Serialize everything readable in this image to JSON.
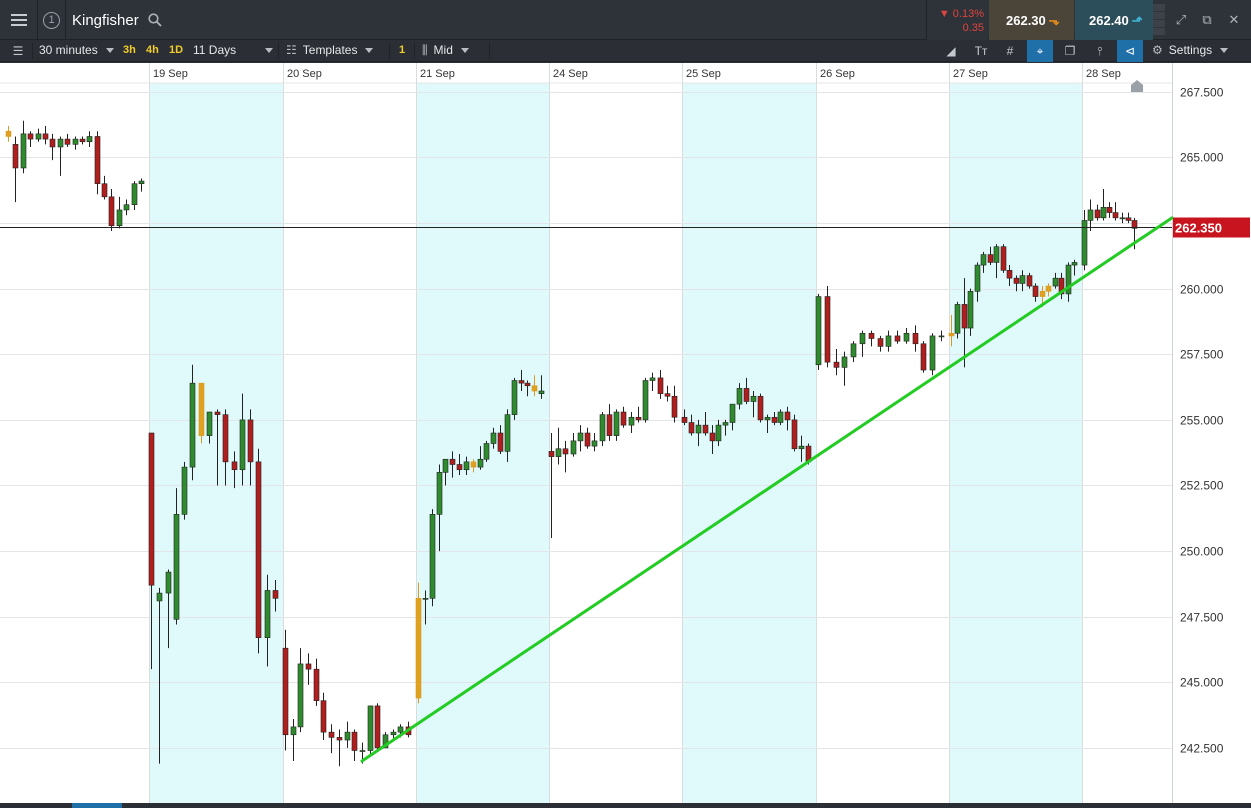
{
  "topbar": {
    "instrument": "Kingfisher",
    "window_number": "1",
    "price_change_pct": "▼ 0.13%",
    "price_change_abs": "0.35",
    "sell_price": "262.30",
    "buy_price": "262.40"
  },
  "toolbar": {
    "interval": "30 minutes",
    "preset_3h": "3h",
    "preset_4h": "4h",
    "preset_1d": "1D",
    "range": "11 Days",
    "templates": "Templates",
    "templates_count": "1",
    "price_type": "Mid",
    "settings": "Settings"
  },
  "colors": {
    "up": "#2e8b2e",
    "down": "#b01e1e",
    "trendline": "#22cc22",
    "band": "#e0fafc",
    "current_price_tag": "#c8141e"
  },
  "chart_data": {
    "type": "candlestick",
    "x_dates": [
      "19 Sep",
      "20 Sep",
      "21 Sep",
      "24 Sep",
      "25 Sep",
      "26 Sep",
      "27 Sep",
      "28 Sep"
    ],
    "y_ticks": [
      "267.500",
      "265.000",
      "262.500",
      "260.000",
      "257.500",
      "255.000",
      "252.500",
      "250.000",
      "247.500",
      "245.000",
      "242.500"
    ],
    "ylim": [
      240.4,
      268.6
    ],
    "current_price": 262.35,
    "current_price_label": "262.350",
    "trendline": {
      "from": {
        "date": "20 Sep",
        "value": 242.0
      },
      "to": {
        "date": "28 Sep",
        "value": 262.7
      }
    },
    "candles": [
      [
        265.8,
        266.2,
        265.6,
        266.0
      ],
      [
        265.5,
        265.8,
        263.3,
        264.6
      ],
      [
        264.6,
        266.4,
        264.4,
        265.9
      ],
      [
        265.9,
        266.0,
        265.4,
        265.7
      ],
      [
        265.7,
        266.1,
        265.6,
        265.9
      ],
      [
        265.9,
        266.2,
        265.5,
        265.7
      ],
      [
        265.7,
        265.9,
        264.9,
        265.4
      ],
      [
        265.4,
        265.8,
        264.3,
        265.7
      ],
      [
        265.7,
        265.9,
        265.4,
        265.5
      ],
      [
        265.5,
        265.8,
        265.3,
        265.7
      ],
      [
        265.7,
        265.8,
        265.5,
        265.6
      ],
      [
        265.6,
        266.0,
        265.4,
        265.8
      ],
      [
        265.8,
        266.0,
        263.6,
        264.0
      ],
      [
        264.0,
        264.3,
        263.4,
        263.5
      ],
      [
        263.5,
        263.8,
        262.2,
        262.4
      ],
      [
        262.4,
        263.5,
        262.3,
        263.0
      ],
      [
        263.0,
        263.4,
        262.8,
        263.2
      ],
      [
        263.2,
        264.1,
        263.0,
        264.0
      ],
      [
        264.0,
        264.2,
        263.7,
        264.1
      ],
      [
        254.5,
        254.5,
        245.5,
        248.7
      ],
      [
        248.1,
        248.6,
        241.9,
        248.4
      ],
      [
        248.4,
        249.3,
        246.3,
        249.2
      ],
      [
        247.4,
        252.4,
        247.2,
        251.4
      ],
      [
        251.4,
        253.4,
        251.2,
        253.2
      ],
      [
        253.2,
        257.1,
        252.7,
        256.4
      ],
      [
        256.4,
        256.4,
        254.1,
        254.4
      ],
      [
        254.4,
        255.3,
        254.1,
        255.3
      ],
      [
        255.3,
        255.4,
        252.5,
        255.2
      ],
      [
        255.2,
        255.4,
        252.5,
        253.4
      ],
      [
        253.4,
        253.8,
        252.4,
        253.1
      ],
      [
        253.1,
        256.0,
        252.5,
        255.0
      ],
      [
        255.0,
        255.4,
        252.5,
        253.4
      ],
      [
        253.4,
        253.9,
        246.1,
        246.7
      ],
      [
        246.7,
        249.1,
        245.6,
        248.5
      ],
      [
        248.5,
        248.9,
        247.7,
        248.2
      ],
      [
        246.3,
        247.0,
        242.4,
        243.0
      ],
      [
        243.0,
        243.6,
        242.0,
        243.3
      ],
      [
        243.3,
        246.3,
        243.1,
        245.7
      ],
      [
        245.7,
        246.1,
        244.9,
        245.5
      ],
      [
        245.5,
        245.9,
        244.1,
        244.3
      ],
      [
        244.3,
        244.6,
        242.8,
        243.1
      ],
      [
        243.1,
        243.4,
        242.3,
        242.9
      ],
      [
        242.9,
        243.2,
        241.8,
        242.8
      ],
      [
        242.8,
        243.5,
        242.5,
        243.1
      ],
      [
        243.1,
        243.2,
        242.0,
        242.4
      ],
      [
        242.4,
        242.7,
        241.9,
        242.4
      ],
      [
        242.4,
        244.1,
        242.2,
        244.1
      ],
      [
        244.1,
        244.2,
        242.4,
        242.5
      ],
      [
        242.5,
        243.1,
        242.5,
        243.0
      ],
      [
        243.0,
        243.2,
        242.8,
        243.1
      ],
      [
        243.1,
        243.4,
        242.9,
        243.3
      ],
      [
        243.3,
        243.5,
        242.9,
        243.0
      ],
      [
        244.4,
        248.8,
        244.2,
        248.2
      ],
      [
        248.2,
        248.5,
        247.2,
        248.2
      ],
      [
        248.2,
        251.6,
        247.9,
        251.4
      ],
      [
        251.4,
        253.3,
        250.0,
        253.0
      ],
      [
        253.0,
        253.5,
        252.5,
        253.5
      ],
      [
        253.5,
        253.8,
        252.8,
        253.3
      ],
      [
        253.3,
        253.7,
        252.9,
        253.1
      ],
      [
        253.1,
        253.6,
        252.9,
        253.4
      ],
      [
        253.4,
        253.5,
        253.0,
        253.2
      ],
      [
        253.2,
        254.0,
        253.1,
        253.5
      ],
      [
        253.5,
        254.2,
        253.4,
        254.1
      ],
      [
        254.1,
        254.7,
        253.9,
        254.5
      ],
      [
        254.5,
        254.8,
        253.7,
        253.8
      ],
      [
        253.8,
        255.4,
        253.4,
        255.2
      ],
      [
        255.2,
        256.6,
        255.0,
        256.5
      ],
      [
        256.5,
        256.9,
        256.1,
        256.4
      ],
      [
        256.4,
        256.5,
        255.9,
        256.3
      ],
      [
        256.3,
        256.7,
        255.9,
        256.1
      ],
      [
        256.0,
        256.7,
        255.8,
        256.1
      ],
      [
        253.8,
        254.5,
        250.5,
        253.6
      ],
      [
        253.6,
        254.7,
        253.3,
        253.9
      ],
      [
        253.9,
        254.2,
        253.0,
        253.7
      ],
      [
        253.7,
        254.5,
        253.6,
        254.2
      ],
      [
        254.2,
        254.8,
        253.8,
        254.5
      ],
      [
        254.5,
        254.7,
        253.9,
        254.0
      ],
      [
        254.0,
        254.5,
        253.8,
        254.2
      ],
      [
        254.2,
        255.3,
        254.0,
        255.2
      ],
      [
        255.2,
        255.6,
        254.2,
        254.4
      ],
      [
        254.4,
        255.4,
        254.2,
        255.3
      ],
      [
        255.3,
        255.5,
        254.7,
        254.8
      ],
      [
        254.8,
        255.3,
        254.5,
        255.1
      ],
      [
        255.1,
        255.5,
        254.9,
        255.0
      ],
      [
        255.0,
        256.6,
        254.9,
        256.5
      ],
      [
        256.5,
        256.8,
        256.1,
        256.6
      ],
      [
        256.6,
        256.9,
        255.8,
        256.0
      ],
      [
        256.0,
        256.3,
        255.7,
        255.9
      ],
      [
        255.9,
        256.3,
        254.9,
        255.1
      ],
      [
        255.1,
        255.4,
        254.8,
        254.9
      ],
      [
        254.9,
        255.2,
        254.4,
        254.5
      ],
      [
        254.5,
        255.0,
        254.0,
        254.8
      ],
      [
        254.8,
        255.3,
        254.4,
        254.5
      ],
      [
        254.5,
        254.8,
        253.7,
        254.2
      ],
      [
        254.2,
        255.0,
        254.0,
        254.8
      ],
      [
        254.8,
        255.0,
        254.4,
        254.9
      ],
      [
        254.9,
        255.6,
        254.6,
        255.6
      ],
      [
        255.6,
        256.4,
        255.4,
        256.2
      ],
      [
        256.2,
        256.6,
        255.6,
        255.7
      ],
      [
        255.7,
        256.1,
        255.1,
        255.9
      ],
      [
        255.9,
        256.0,
        254.9,
        255.0
      ],
      [
        255.0,
        255.2,
        254.5,
        255.1
      ],
      [
        255.1,
        255.3,
        254.8,
        254.9
      ],
      [
        254.9,
        255.4,
        254.8,
        255.3
      ],
      [
        255.3,
        255.5,
        254.6,
        255.0
      ],
      [
        255.0,
        255.2,
        253.8,
        253.9
      ],
      [
        253.9,
        254.4,
        253.4,
        254.0
      ],
      [
        254.0,
        254.1,
        253.3,
        253.4
      ],
      [
        257.1,
        259.8,
        256.9,
        259.7
      ],
      [
        259.7,
        260.1,
        257.0,
        257.2
      ],
      [
        257.2,
        257.7,
        256.7,
        257.0
      ],
      [
        257.0,
        257.6,
        256.3,
        257.4
      ],
      [
        257.4,
        258.0,
        257.2,
        257.9
      ],
      [
        257.9,
        258.4,
        257.4,
        258.3
      ],
      [
        258.3,
        258.4,
        257.8,
        258.1
      ],
      [
        258.1,
        258.2,
        257.6,
        257.8
      ],
      [
        257.8,
        258.4,
        257.6,
        258.2
      ],
      [
        258.2,
        258.4,
        257.9,
        258.0
      ],
      [
        258.0,
        258.5,
        257.9,
        258.3
      ],
      [
        258.3,
        258.6,
        257.6,
        257.9
      ],
      [
        257.9,
        258.0,
        256.8,
        256.9
      ],
      [
        256.9,
        258.3,
        256.7,
        258.2
      ],
      [
        258.2,
        258.4,
        258.0,
        258.2
      ],
      [
        258.2,
        259.0,
        257.8,
        258.3
      ],
      [
        258.3,
        259.5,
        258.1,
        259.4
      ],
      [
        259.4,
        260.4,
        257.0,
        258.5
      ],
      [
        258.5,
        260.0,
        258.2,
        259.9
      ],
      [
        259.9,
        261.0,
        259.5,
        260.9
      ],
      [
        260.9,
        261.4,
        260.6,
        261.3
      ],
      [
        261.3,
        261.6,
        260.9,
        261.0
      ],
      [
        261.0,
        261.7,
        260.4,
        261.6
      ],
      [
        261.6,
        261.7,
        260.6,
        260.7
      ],
      [
        260.7,
        260.9,
        260.1,
        260.4
      ],
      [
        260.4,
        260.5,
        259.9,
        260.2
      ],
      [
        260.2,
        260.7,
        259.9,
        260.5
      ],
      [
        260.5,
        260.6,
        260.0,
        260.1
      ],
      [
        260.1,
        260.2,
        259.5,
        259.7
      ],
      [
        259.7,
        260.1,
        259.3,
        259.9
      ],
      [
        259.9,
        260.2,
        259.7,
        260.1
      ],
      [
        260.1,
        260.6,
        260.0,
        260.4
      ],
      [
        260.4,
        260.6,
        259.6,
        259.8
      ],
      [
        259.8,
        261.0,
        259.5,
        260.9
      ],
      [
        260.9,
        261.1,
        260.5,
        261.0
      ],
      [
        260.9,
        263.0,
        260.7,
        262.6
      ],
      [
        262.6,
        263.4,
        262.2,
        263.0
      ],
      [
        263.0,
        263.2,
        262.6,
        262.7
      ],
      [
        262.7,
        263.8,
        262.6,
        263.1
      ],
      [
        263.1,
        263.3,
        262.7,
        262.9
      ],
      [
        262.9,
        263.3,
        262.6,
        262.7
      ],
      [
        262.7,
        262.9,
        262.5,
        262.7
      ],
      [
        262.7,
        262.9,
        262.5,
        262.6
      ],
      [
        262.6,
        262.7,
        261.5,
        262.3
      ]
    ],
    "doji_indices": [
      0,
      25,
      52,
      60,
      69,
      123,
      137,
      138
    ],
    "day_boundaries": [
      19,
      35,
      52,
      71,
      89,
      108,
      123,
      143
    ]
  }
}
